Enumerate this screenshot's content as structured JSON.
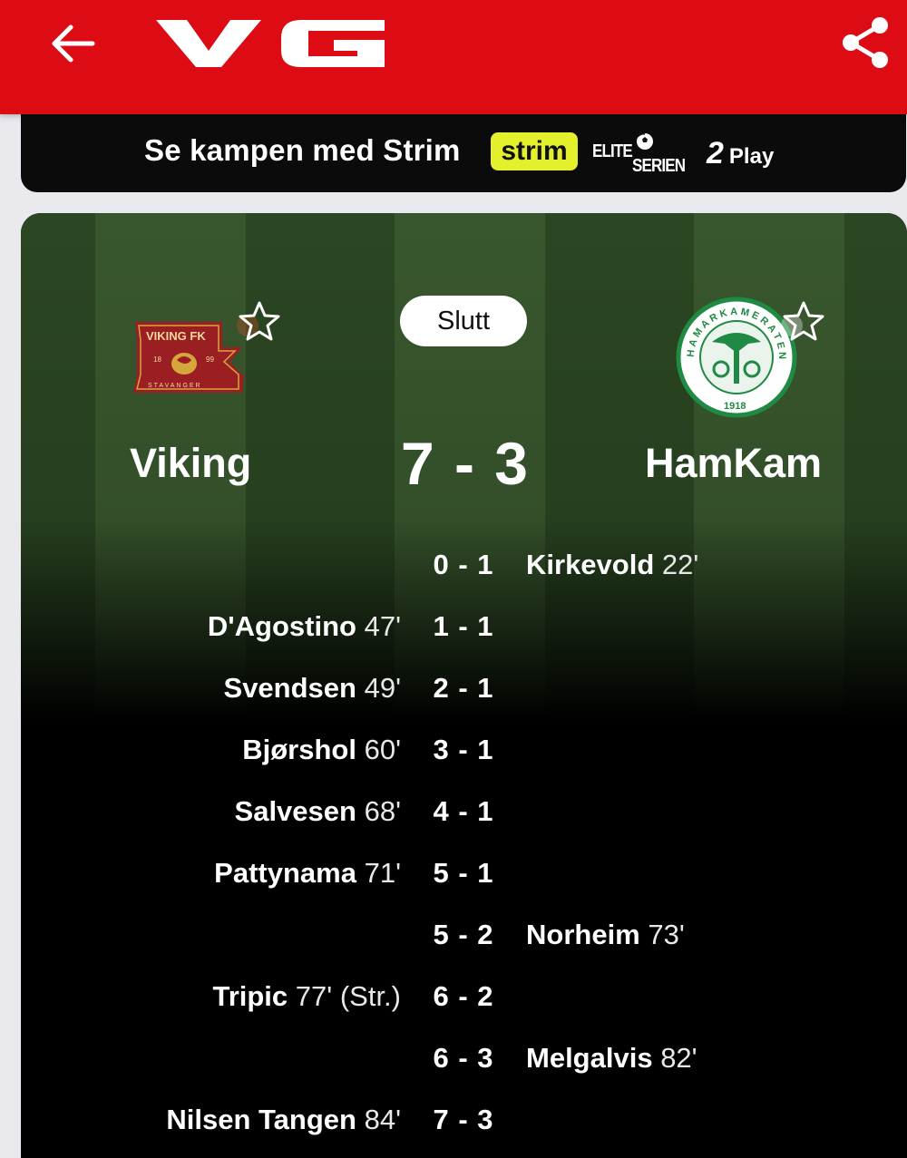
{
  "header": {
    "back_icon": "arrow-left-icon",
    "logo_text": "VG",
    "share_icon": "share-icon",
    "brand_color": "#dc0b14"
  },
  "stream_banner": {
    "text": "Se kampen med Strim",
    "strim_logo": "strim",
    "eliteserien_logo": [
      "ELITE",
      "SERIEN"
    ],
    "play_logo_num": "2",
    "play_logo_text": "Play"
  },
  "match": {
    "status": "Slutt",
    "home": {
      "name": "Viking",
      "crest_lines": [
        "VIKING FK",
        "18",
        "99",
        "STAVANGER"
      ],
      "crest_color": "#9b1e22"
    },
    "away": {
      "name": "HamKam",
      "crest_lines": [
        "HAMARKAMERATENE",
        "1918"
      ],
      "crest_color": "#1f8a43"
    },
    "score": "7 - 3",
    "favorite_icon": "star-outline-icon",
    "goals": [
      {
        "side": "away",
        "score": "0 - 1",
        "player": "Kirkevold",
        "minute": "22'",
        "note": ""
      },
      {
        "side": "home",
        "score": "1 - 1",
        "player": "D'Agostino",
        "minute": "47'",
        "note": ""
      },
      {
        "side": "home",
        "score": "2 - 1",
        "player": "Svendsen",
        "minute": "49'",
        "note": ""
      },
      {
        "side": "home",
        "score": "3 - 1",
        "player": "Bjørshol",
        "minute": "60'",
        "note": ""
      },
      {
        "side": "home",
        "score": "4 - 1",
        "player": "Salvesen",
        "minute": "68'",
        "note": ""
      },
      {
        "side": "home",
        "score": "5 - 1",
        "player": "Pattynama",
        "minute": "71'",
        "note": ""
      },
      {
        "side": "away",
        "score": "5 - 2",
        "player": "Norheim",
        "minute": "73'",
        "note": ""
      },
      {
        "side": "home",
        "score": "6 - 2",
        "player": "Tripic",
        "minute": "77'",
        "note": "(Str.)"
      },
      {
        "side": "away",
        "score": "6 - 3",
        "player": "Melgalvis",
        "minute": "82'",
        "note": ""
      },
      {
        "side": "home",
        "score": "7 - 3",
        "player": "Nilsen Tangen",
        "minute": "84'",
        "note": ""
      }
    ]
  }
}
